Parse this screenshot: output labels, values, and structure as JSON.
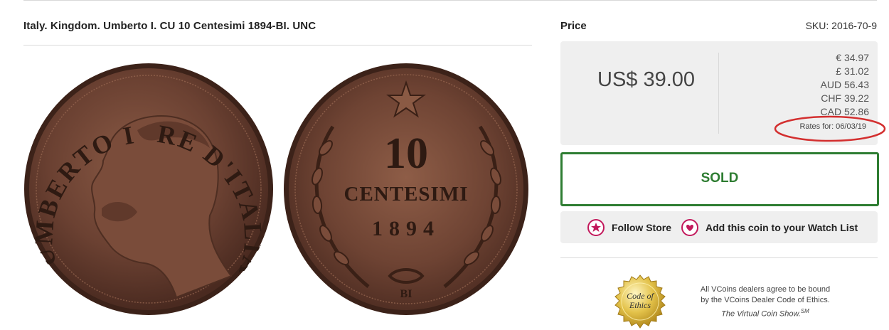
{
  "listing": {
    "title": "Italy. Kingdom. Umberto I. CU 10 Centesimi 1894-BI. UNC"
  },
  "obverse": {
    "legend_left": "UMBERTO I",
    "legend_right": "RE D'ITALIA"
  },
  "reverse": {
    "denomination": "10",
    "unit": "CENTESIMI",
    "year": "1894",
    "mint_mark": "BI"
  },
  "price": {
    "label": "Price",
    "sku": "SKU: 2016-70-9",
    "main": "US$ 39.00",
    "conversions": [
      "€ 34.97",
      "£ 31.02",
      "AUD 56.43",
      "CHF 39.22",
      "CAD 52.86"
    ],
    "rates_date": "Rates for: 06/03/19"
  },
  "status": {
    "sold_label": "SOLD",
    "color": "#2e7d32"
  },
  "actions": {
    "follow_label": "Follow Store",
    "watch_label": "Add this coin to your Watch List",
    "icon_color": "#c2185b"
  },
  "ethics": {
    "seal_line1": "Code of",
    "seal_line2": "Ethics",
    "text1": "All VCoins dealers agree to be bound",
    "text2": "by the VCoins Dealer Code of Ethics.",
    "text3": "The Virtual Coin Show.",
    "sm": "SM"
  }
}
